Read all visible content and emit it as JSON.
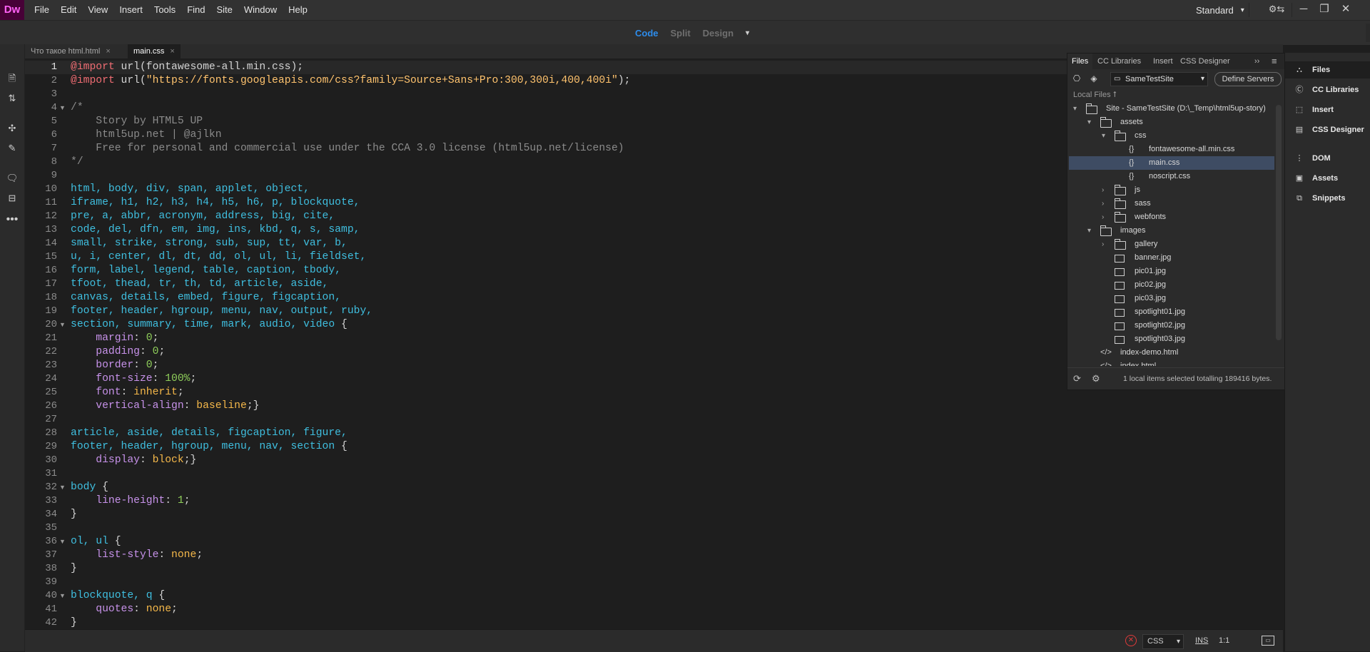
{
  "app": {
    "logo": "Dw"
  },
  "menu": [
    "File",
    "Edit",
    "View",
    "Insert",
    "Tools",
    "Find",
    "Site",
    "Window",
    "Help"
  ],
  "workspace": {
    "label": "Standard",
    "chevron": "▾",
    "sync_icon": "⚙⇆",
    "minimize": "─",
    "restore": "❐",
    "close": "✕"
  },
  "views": {
    "code": "Code",
    "split": "Split",
    "design": "Design",
    "dropdown": "▾"
  },
  "tabs": [
    {
      "label": "Что такое html.html",
      "close": "×"
    },
    {
      "label": "main.css",
      "close": "×"
    }
  ],
  "editor": {
    "line_numbers": [
      "1",
      "2",
      "3",
      "4",
      "5",
      "6",
      "7",
      "8",
      "9",
      "10",
      "11",
      "12",
      "13",
      "14",
      "15",
      "16",
      "17",
      "18",
      "19",
      "20",
      "21",
      "22",
      "23",
      "24",
      "25",
      "26",
      "27",
      "28",
      "29",
      "30",
      "31",
      "32",
      "33",
      "34",
      "35",
      "36",
      "37",
      "38",
      "39",
      "40",
      "41",
      "42"
    ],
    "fold_markers": [
      {
        "line": 4,
        "glyph": "▼"
      },
      {
        "line": 20,
        "glyph": "▼"
      },
      {
        "line": 32,
        "glyph": "▼"
      },
      {
        "line": 36,
        "glyph": "▼"
      },
      {
        "line": 40,
        "glyph": "▼"
      }
    ],
    "code_lines": [
      [
        {
          "t": "@import",
          "c": "kw"
        },
        {
          "t": " url(fontawesome-all.min.css);",
          "c": "pu"
        }
      ],
      [
        {
          "t": "@import",
          "c": "kw"
        },
        {
          "t": " url(",
          "c": "pu"
        },
        {
          "t": "\"https://fonts.googleapis.com/css?family=Source+Sans+Pro:300,300i,400,400i\"",
          "c": "str"
        },
        {
          "t": ");",
          "c": "pu"
        }
      ],
      [],
      [
        {
          "t": "/*",
          "c": "cm"
        }
      ],
      [
        {
          "t": "    Story by HTML5 UP",
          "c": "cm"
        }
      ],
      [
        {
          "t": "    html5up.net | @ajlkn",
          "c": "cm"
        }
      ],
      [
        {
          "t": "    Free for personal and commercial use under the CCA 3.0 license (html5up.net/license)",
          "c": "cm"
        }
      ],
      [
        {
          "t": "*/",
          "c": "cm"
        }
      ],
      [],
      [
        {
          "t": "html, body, div, span, applet, object,",
          "c": "sel"
        }
      ],
      [
        {
          "t": "iframe, h1, h2, h3, h4, h5, h6, p, blockquote,",
          "c": "sel"
        }
      ],
      [
        {
          "t": "pre, a, abbr, acronym, address, big, cite,",
          "c": "sel"
        }
      ],
      [
        {
          "t": "code, del, dfn, em, img, ins, kbd, q, s, samp,",
          "c": "sel"
        }
      ],
      [
        {
          "t": "small, strike, strong, sub, sup, tt, var, b,",
          "c": "sel"
        }
      ],
      [
        {
          "t": "u, i, center, dl, dt, dd, ol, ul, li, fieldset,",
          "c": "sel"
        }
      ],
      [
        {
          "t": "form, label, legend, table, caption, tbody,",
          "c": "sel"
        }
      ],
      [
        {
          "t": "tfoot, thead, tr, th, td, article, aside,",
          "c": "sel"
        }
      ],
      [
        {
          "t": "canvas, details, embed, figure, figcaption,",
          "c": "sel"
        }
      ],
      [
        {
          "t": "footer, header, hgroup, menu, nav, output, ruby,",
          "c": "sel"
        }
      ],
      [
        {
          "t": "section, summary, time, mark, audio, video ",
          "c": "sel"
        },
        {
          "t": "{",
          "c": "pu"
        }
      ],
      [
        {
          "t": "    margin",
          "c": "prop"
        },
        {
          "t": ": ",
          "c": "pu"
        },
        {
          "t": "0",
          "c": "num"
        },
        {
          "t": ";",
          "c": "pu"
        }
      ],
      [
        {
          "t": "    padding",
          "c": "prop"
        },
        {
          "t": ": ",
          "c": "pu"
        },
        {
          "t": "0",
          "c": "num"
        },
        {
          "t": ";",
          "c": "pu"
        }
      ],
      [
        {
          "t": "    border",
          "c": "prop"
        },
        {
          "t": ": ",
          "c": "pu"
        },
        {
          "t": "0",
          "c": "num"
        },
        {
          "t": ";",
          "c": "pu"
        }
      ],
      [
        {
          "t": "    font-size",
          "c": "prop"
        },
        {
          "t": ": ",
          "c": "pu"
        },
        {
          "t": "100%",
          "c": "num"
        },
        {
          "t": ";",
          "c": "pu"
        }
      ],
      [
        {
          "t": "    font",
          "c": "prop"
        },
        {
          "t": ": ",
          "c": "pu"
        },
        {
          "t": "inherit",
          "c": "val"
        },
        {
          "t": ";",
          "c": "pu"
        }
      ],
      [
        {
          "t": "    vertical-align",
          "c": "prop"
        },
        {
          "t": ": ",
          "c": "pu"
        },
        {
          "t": "baseline",
          "c": "val"
        },
        {
          "t": ";}",
          "c": "pu"
        }
      ],
      [],
      [
        {
          "t": "article, aside, details, figcaption, figure,",
          "c": "sel"
        }
      ],
      [
        {
          "t": "footer, header, hgroup, menu, nav, section ",
          "c": "sel"
        },
        {
          "t": "{",
          "c": "pu"
        }
      ],
      [
        {
          "t": "    display",
          "c": "prop"
        },
        {
          "t": ": ",
          "c": "pu"
        },
        {
          "t": "block",
          "c": "val"
        },
        {
          "t": ";}",
          "c": "pu"
        }
      ],
      [],
      [
        {
          "t": "body ",
          "c": "sel"
        },
        {
          "t": "{",
          "c": "pu"
        }
      ],
      [
        {
          "t": "    line-height",
          "c": "prop"
        },
        {
          "t": ": ",
          "c": "pu"
        },
        {
          "t": "1",
          "c": "num"
        },
        {
          "t": ";",
          "c": "pu"
        }
      ],
      [
        {
          "t": "}",
          "c": "pu"
        }
      ],
      [],
      [
        {
          "t": "ol, ul ",
          "c": "sel"
        },
        {
          "t": "{",
          "c": "pu"
        }
      ],
      [
        {
          "t": "    list-style",
          "c": "prop"
        },
        {
          "t": ": ",
          "c": "pu"
        },
        {
          "t": "none",
          "c": "val"
        },
        {
          "t": ";",
          "c": "pu"
        }
      ],
      [
        {
          "t": "}",
          "c": "pu"
        }
      ],
      [],
      [
        {
          "t": "blockquote, q ",
          "c": "sel"
        },
        {
          "t": "{",
          "c": "pu"
        }
      ],
      [
        {
          "t": "    quotes",
          "c": "prop"
        },
        {
          "t": ": ",
          "c": "pu"
        },
        {
          "t": "none",
          "c": "val"
        },
        {
          "t": ";",
          "c": "pu"
        }
      ],
      [
        {
          "t": "}",
          "c": "pu"
        }
      ]
    ]
  },
  "files_panel": {
    "tabs": [
      "Files",
      "CC Libraries",
      "Insert",
      "CSS Designer"
    ],
    "collapse": "››",
    "menu": "≡",
    "site_select": "SameTestSite",
    "define_servers": "Define Servers",
    "local_files": "Local Files ⭡",
    "tree": [
      {
        "indent": 0,
        "expand": "▾",
        "type": "folder",
        "label": "Site - SameTestSite (D:\\_Temp\\html5up-story)"
      },
      {
        "indent": 1,
        "expand": "▾",
        "type": "folder",
        "label": "assets"
      },
      {
        "indent": 2,
        "expand": "▾",
        "type": "folder",
        "label": "css"
      },
      {
        "indent": 3,
        "expand": "",
        "type": "css",
        "label": "fontawesome-all.min.css"
      },
      {
        "indent": 3,
        "expand": "",
        "type": "css",
        "label": "main.css",
        "selected": true
      },
      {
        "indent": 3,
        "expand": "",
        "type": "css",
        "label": "noscript.css"
      },
      {
        "indent": 2,
        "expand": "›",
        "type": "folder",
        "label": "js"
      },
      {
        "indent": 2,
        "expand": "›",
        "type": "folder",
        "label": "sass"
      },
      {
        "indent": 2,
        "expand": "›",
        "type": "folder",
        "label": "webfonts"
      },
      {
        "indent": 1,
        "expand": "▾",
        "type": "folder",
        "label": "images"
      },
      {
        "indent": 2,
        "expand": "›",
        "type": "folder",
        "label": "gallery"
      },
      {
        "indent": 2,
        "expand": "",
        "type": "image",
        "label": "banner.jpg"
      },
      {
        "indent": 2,
        "expand": "",
        "type": "image",
        "label": "pic01.jpg"
      },
      {
        "indent": 2,
        "expand": "",
        "type": "image",
        "label": "pic02.jpg"
      },
      {
        "indent": 2,
        "expand": "",
        "type": "image",
        "label": "pic03.jpg"
      },
      {
        "indent": 2,
        "expand": "",
        "type": "image",
        "label": "spotlight01.jpg"
      },
      {
        "indent": 2,
        "expand": "",
        "type": "image",
        "label": "spotlight02.jpg"
      },
      {
        "indent": 2,
        "expand": "",
        "type": "image",
        "label": "spotlight03.jpg"
      },
      {
        "indent": 1,
        "expand": "",
        "type": "html",
        "label": "index-demo.html"
      },
      {
        "indent": 1,
        "expand": "",
        "type": "html",
        "label": "index.html"
      }
    ],
    "status": "1 local items selected totalling 189416 bytes."
  },
  "right_dock": [
    {
      "icon": "⛬",
      "label": "Files"
    },
    {
      "icon": "Ⓒ",
      "label": "CC Libraries"
    },
    {
      "icon": "⬚",
      "label": "Insert"
    },
    {
      "icon": "▤",
      "label": "CSS Designer"
    },
    {
      "icon": "⋮",
      "label": "DOM"
    },
    {
      "icon": "▣",
      "label": "Assets"
    },
    {
      "icon": "⧉",
      "label": "Snippets"
    }
  ],
  "status_bar": {
    "error_icon": "✕",
    "language": "CSS",
    "language_chevron": "▾",
    "mode": "INS",
    "position": "1:1",
    "preview_icon": "▭"
  }
}
